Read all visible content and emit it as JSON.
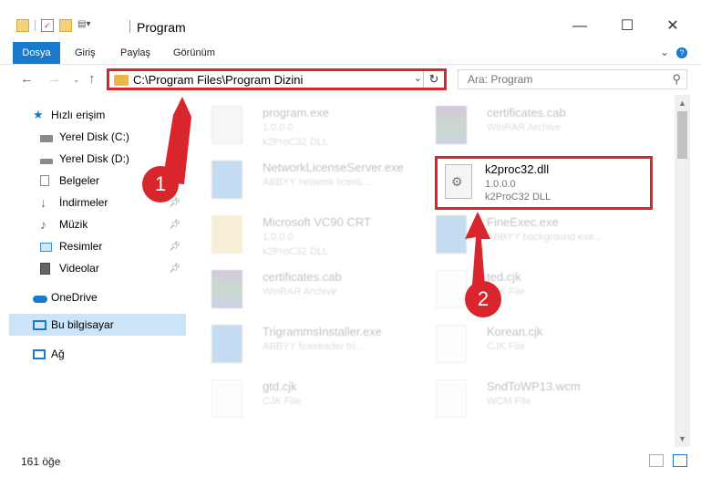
{
  "window": {
    "title": "Program",
    "minimize_icon": "minimize-icon",
    "maximize_icon": "maximize-icon",
    "close_icon": "close-icon"
  },
  "ribbon": {
    "tabs": [
      "Dosya",
      "Giriş",
      "Paylaş",
      "Görünüm"
    ],
    "accent": "#1979ca"
  },
  "address": {
    "path": "C:\\Program Files\\Program Dizini"
  },
  "search": {
    "placeholder": "Ara: Program"
  },
  "sidebar": {
    "quick_access": "Hızlı erişim",
    "items": [
      {
        "label": "Yerel Disk (C:)",
        "icon": "drive-icon"
      },
      {
        "label": "Yerel Disk (D:)",
        "icon": "drive-icon"
      },
      {
        "label": "Belgeler",
        "icon": "documents-icon"
      },
      {
        "label": "İndirmeler",
        "icon": "download-icon"
      },
      {
        "label": "Müzik",
        "icon": "music-icon"
      },
      {
        "label": "Resimler",
        "icon": "pictures-icon"
      },
      {
        "label": "Videolar",
        "icon": "videos-icon"
      }
    ],
    "onedrive": "OneDrive",
    "this_pc": "Bu bilgisayar",
    "network": "Ağ"
  },
  "files": [
    {
      "name": "program.exe",
      "l1": "1.0.0.0",
      "l2": "k2ProC32 DLL"
    },
    {
      "name": "certificates.cab",
      "l1": "WinRAR Archive",
      "l2": ""
    },
    {
      "name": "NetworkLicenseServer.exe",
      "l1": "ABBYY network licens...",
      "l2": ""
    },
    {
      "name": "k2proc32.dll",
      "l1": "1.0.0.0",
      "l2": "k2ProC32 DLL"
    },
    {
      "name": "Microsoft VC90 CRT",
      "l1": "1.0.0.0",
      "l2": "k2ProC32 DLL"
    },
    {
      "name": "FineExec.exe",
      "l1": "ABBYY background exe...",
      "l2": ""
    },
    {
      "name": "certificates.cab",
      "l1": "WinRAR Archive",
      "l2": ""
    },
    {
      "name": "ted.cjk",
      "l1": "CJK File",
      "l2": ""
    },
    {
      "name": "TrigrammsInstaller.exe",
      "l1": "ABBYY finereader tri...",
      "l2": ""
    },
    {
      "name": "Korean.cjk",
      "l1": "CJK File",
      "l2": ""
    },
    {
      "name": "gtd.cjk",
      "l1": "CJK File",
      "l2": ""
    },
    {
      "name": "SndToWP13.wcm",
      "l1": "WCM File",
      "l2": ""
    }
  ],
  "annotations": {
    "step1": "1",
    "step2": "2",
    "color": "#d9262c"
  },
  "status": {
    "count": "161 öğe"
  }
}
